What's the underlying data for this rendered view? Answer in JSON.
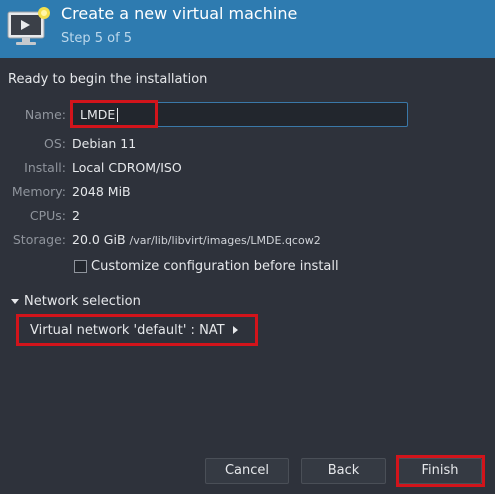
{
  "header": {
    "title": "Create a new virtual machine",
    "step": "Step 5 of 5",
    "icon": "monitor-with-star-icon"
  },
  "summary": {
    "heading": "Ready to begin the installation",
    "name_label": "Name:",
    "name_value": "LMDE",
    "os_label": "OS:",
    "os_value": "Debian 11",
    "install_label": "Install:",
    "install_value": "Local CDROM/ISO",
    "memory_label": "Memory:",
    "memory_value": "2048 MiB",
    "cpus_label": "CPUs:",
    "cpus_value": "2",
    "storage_label": "Storage:",
    "storage_size": "20.0 GiB",
    "storage_path": "/var/lib/libvirt/images/LMDE.qcow2"
  },
  "customize": {
    "label": "Customize configuration before install",
    "checked": false
  },
  "network": {
    "section_label": "Network selection",
    "selection": "Virtual network 'default' : NAT"
  },
  "buttons": {
    "cancel": "Cancel",
    "back": "Back",
    "finish": "Finish"
  },
  "colors": {
    "header_bg": "#2e7bb0",
    "window_bg": "#2e323b",
    "highlight": "#d2141b"
  }
}
